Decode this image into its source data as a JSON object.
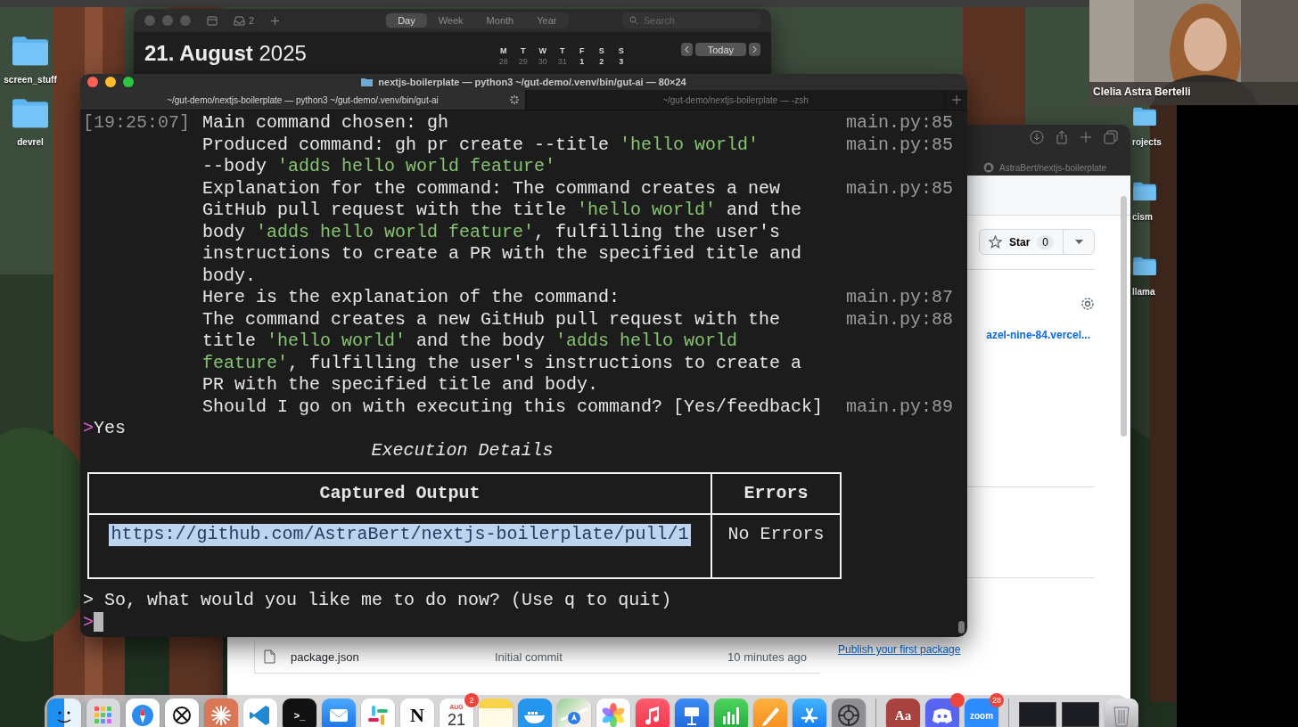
{
  "desktop_icons_left": [
    {
      "label": "screen_stuff"
    },
    {
      "label": "devrel"
    }
  ],
  "desktop_icons_right": [
    {
      "label": "rojects"
    },
    {
      "label": "cism"
    },
    {
      "label": "llama"
    }
  ],
  "calendar_window": {
    "inbox_count": "2",
    "views": [
      {
        "label": "Day",
        "selected": true
      },
      {
        "label": "Week",
        "selected": false
      },
      {
        "label": "Month",
        "selected": false
      },
      {
        "label": "Year",
        "selected": false
      }
    ],
    "search": {
      "placeholder": "Search"
    },
    "date_bold": "21. August",
    "year": "2025",
    "weekdays": [
      "M",
      "T",
      "W",
      "T",
      "F",
      "S",
      "S"
    ],
    "days": [
      {
        "label": "28",
        "current_month": false
      },
      {
        "label": "29",
        "current_month": false
      },
      {
        "label": "30",
        "current_month": false
      },
      {
        "label": "31",
        "current_month": false
      },
      {
        "label": "1",
        "current_month": true
      },
      {
        "label": "2",
        "current_month": true
      },
      {
        "label": "3",
        "current_month": true
      }
    ],
    "today_button": "Today"
  },
  "browser": {
    "tab_title": "AstraBert/nextjs-boilerplate",
    "star_button": {
      "label": "Star",
      "count": "0"
    },
    "website_link": "azel-nine-84.vercel...",
    "files": [
      {
        "name": "package.json",
        "message": "Initial commit",
        "time": "10 minutes ago"
      }
    ],
    "packages_link": "Publish your first package"
  },
  "terminal": {
    "title": "nextjs-boilerplate — python3 ~/gut-demo/.venv/bin/gut-ai — 80×24",
    "tabs": [
      {
        "label": "~/gut-demo/nextjs-boilerplate — python3 ~/gut-demo/.venv/bin/gut-ai",
        "selected": true,
        "busy": true
      },
      {
        "label": "~/gut-demo/nextjs-boilerplate — -zsh",
        "selected": false,
        "busy": false
      }
    ],
    "log_lines": [
      {
        "time": "[19:25:07]",
        "segments": [
          {
            "text": "Main command chosen: gh",
            "kind": "plain"
          }
        ],
        "source": "main.py:85"
      },
      {
        "segments": [
          {
            "text": "Produced command: gh pr create --title ",
            "kind": "plain"
          },
          {
            "text": "'hello world'",
            "kind": "string"
          }
        ],
        "source": "main.py:85"
      },
      {
        "segments": [
          {
            "text": "--body ",
            "kind": "plain"
          },
          {
            "text": "'adds hello world feature'",
            "kind": "string"
          }
        ]
      },
      {
        "segments": [
          {
            "text": "Explanation for the command: The command creates a new",
            "kind": "plain"
          }
        ],
        "source": "main.py:85"
      },
      {
        "segments": [
          {
            "text": "GitHub pull request with the title ",
            "kind": "plain"
          },
          {
            "text": "'hello world'",
            "kind": "string"
          },
          {
            "text": " and the",
            "kind": "plain"
          }
        ]
      },
      {
        "segments": [
          {
            "text": "body ",
            "kind": "plain"
          },
          {
            "text": "'adds hello world feature'",
            "kind": "string"
          },
          {
            "text": ", fulfilling the user's",
            "kind": "plain"
          }
        ]
      },
      {
        "segments": [
          {
            "text": "instructions to create a PR with the specified title and",
            "kind": "plain"
          }
        ]
      },
      {
        "segments": [
          {
            "text": "body.",
            "kind": "plain"
          }
        ]
      },
      {
        "segments": [
          {
            "text": "Here is the explanation of the command:",
            "kind": "plain"
          }
        ],
        "source": "main.py:87"
      },
      {
        "segments": [
          {
            "text": "The command creates a new GitHub pull request with the",
            "kind": "plain"
          }
        ],
        "source": "main.py:88"
      },
      {
        "segments": [
          {
            "text": "title ",
            "kind": "plain"
          },
          {
            "text": "'hello world'",
            "kind": "string"
          },
          {
            "text": " and the body ",
            "kind": "plain"
          },
          {
            "text": "'adds hello world",
            "kind": "string"
          }
        ]
      },
      {
        "segments": [
          {
            "text": "feature'",
            "kind": "string"
          },
          {
            "text": ", fulfilling the user's instructions to create a",
            "kind": "plain"
          }
        ]
      },
      {
        "segments": [
          {
            "text": "PR with the specified title and body.",
            "kind": "plain"
          }
        ]
      },
      {
        "segments": [
          {
            "text": "Should I go on with executing this command? [Yes/feedback]",
            "kind": "plain"
          }
        ],
        "source": "main.py:89"
      }
    ],
    "answer": {
      "prompt": ">",
      "text": "Yes"
    },
    "table_title": "Execution Details",
    "table": {
      "columns": [
        "Captured Output",
        "Errors"
      ],
      "rows": [
        [
          {
            "text": "https://github.com/AstraBert/nextjs-boilerplate/pull/1",
            "selected": true
          },
          {
            "text": "No Errors",
            "selected": false
          }
        ]
      ]
    },
    "question": {
      "prompt": ">",
      "text": "So, what would you like me to do now? (Use q to quit)"
    },
    "input_prompt": ">"
  },
  "video_call": {
    "name": "Clelia Astra Bertelli"
  },
  "dock": {
    "items": [
      {
        "kind": "finder"
      },
      {
        "kind": "launchpad"
      },
      {
        "kind": "safari"
      },
      {
        "kind": "chatgpt"
      },
      {
        "kind": "claude"
      },
      {
        "kind": "vscode"
      },
      {
        "kind": "terminal",
        "label": ">_"
      },
      {
        "kind": "mail"
      },
      {
        "kind": "slack"
      },
      {
        "kind": "notion",
        "label": "N"
      },
      {
        "kind": "calendar",
        "month": "AUG",
        "day": "21",
        "badge": "2"
      },
      {
        "kind": "notes"
      },
      {
        "kind": "docker"
      },
      {
        "kind": "maps"
      },
      {
        "kind": "photos"
      },
      {
        "kind": "music"
      },
      {
        "kind": "keynote"
      },
      {
        "kind": "numbers"
      },
      {
        "kind": "pages"
      },
      {
        "kind": "appstore"
      },
      {
        "kind": "settings"
      },
      {
        "kind": "divider"
      },
      {
        "kind": "dictionary",
        "label": "Aa"
      },
      {
        "kind": "discord",
        "notification": true
      },
      {
        "kind": "zoom",
        "label": "zoom",
        "badge": "28"
      },
      {
        "kind": "divider"
      },
      {
        "kind": "window"
      },
      {
        "kind": "window"
      },
      {
        "kind": "trash"
      }
    ]
  }
}
